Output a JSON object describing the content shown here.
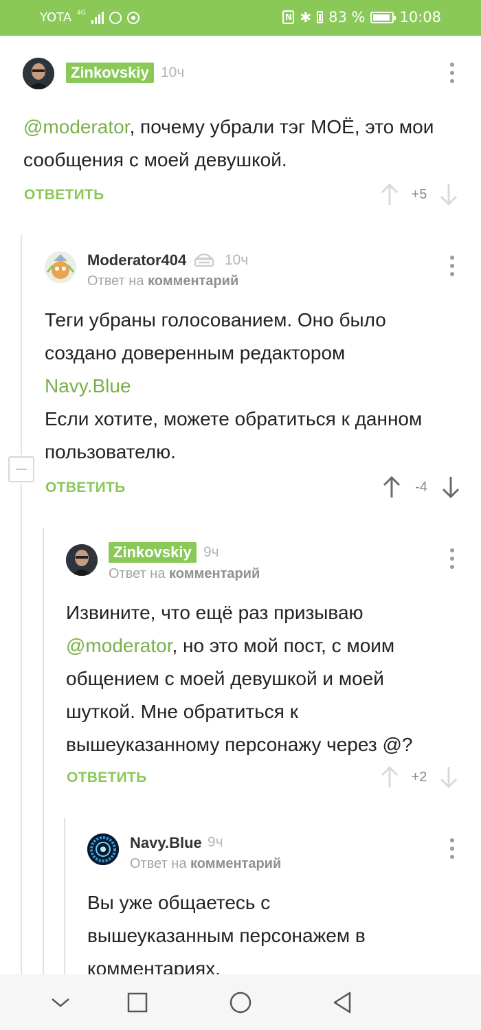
{
  "status_bar": {
    "carrier": "YOTA",
    "network_tag": "4G",
    "battery_percent": "83 %",
    "time": "10:08",
    "icons": [
      "signal-icon",
      "whatsapp-icon",
      "record-icon",
      "nfc-icon",
      "bluetooth-icon",
      "battery-icon",
      "battery-saver-icon"
    ]
  },
  "comments": [
    {
      "author": "Zinkovskiy",
      "time": "10ч",
      "reply_prefix": "",
      "reply_target": "",
      "text": {
        "mention": "@moderator",
        "rest": ", почему убрали тэг МОЁ, это мои сообщения с моей девушкой."
      },
      "reply_label": "ОТВЕТИТЬ",
      "score": "+5"
    },
    {
      "author": "Moderator404",
      "time": "10ч",
      "reply_prefix": "Ответ на",
      "reply_target": "комментарий",
      "text": {
        "line1": "Теги убраны голосованием. Оно было создано доверенным редактором",
        "mention": "Navy.Blue",
        "line2": "Если хотите, можете обратиться к данном пользователю."
      },
      "reply_label": "ОТВЕТИТЬ",
      "score": "-4"
    },
    {
      "author": "Zinkovskiy",
      "time": "9ч",
      "reply_prefix": "Ответ на",
      "reply_target": "комментарий",
      "text": {
        "pre": "Извините, что ещё раз призываю",
        "mention": "@moderator",
        "rest": ", но это мой пост, с моим общением с моей девушкой и моей шуткой. Мне обратиться к вышеуказанному персонажу через @?"
      },
      "reply_label": "ОТВЕТИТЬ",
      "score": "+2"
    },
    {
      "author": "Navy.Blue",
      "time": "9ч",
      "reply_prefix": "Ответ на",
      "reply_target": "комментарий",
      "text": {
        "body": "Вы уже общаетесь с вышеуказанным персонажем в комментариях."
      }
    }
  ],
  "nav_bar": {
    "icons": [
      "collapse-icon",
      "recents-icon",
      "home-icon",
      "back-icon"
    ]
  }
}
